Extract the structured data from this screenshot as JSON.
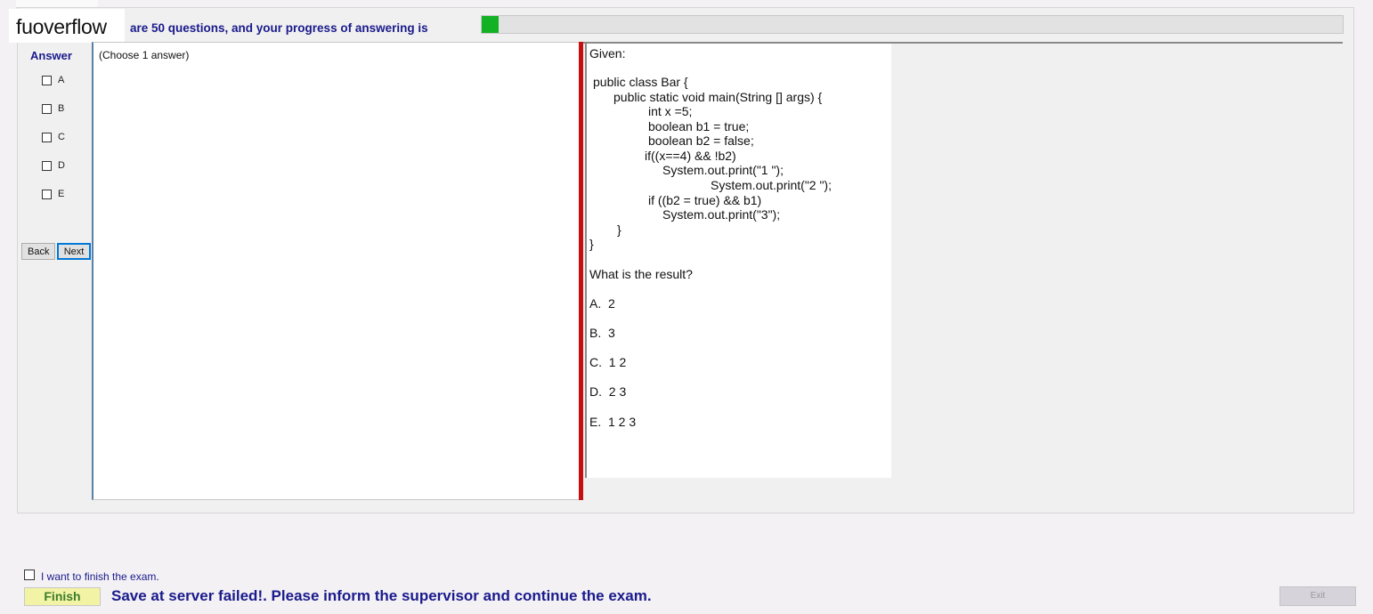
{
  "watermark": "fuoverflow",
  "progress": {
    "text": "are 50 questions, and your progress of answering is",
    "fraction": 0.02,
    "fill_color": "#13b224"
  },
  "answer": {
    "title": "Answer",
    "options": [
      "A",
      "B",
      "C",
      "D",
      "E"
    ]
  },
  "nav": {
    "back_label": "Back",
    "next_label": "Next"
  },
  "choose_text": "(Choose 1 answer)",
  "question": {
    "given": "Given:",
    "code": [
      "public class Bar {",
      "public static void main(String [] args) {",
      "int x =5;",
      "boolean b1 = true;",
      "boolean b2 = false;",
      "if((x==4) && !b2)",
      "System.out.print(\"1 \");",
      "System.out.print(\"2 \");",
      "if ((b2 = true) && b1)",
      "System.out.print(\"3\");",
      "}",
      "}"
    ],
    "prompt": "What is the result?",
    "choices": [
      "A.  2",
      "B.  3",
      "C.  1 2",
      "D.  2 3",
      "E.  1 2 3"
    ]
  },
  "footer": {
    "finish_checkbox_label": "I want to finish the exam.",
    "finish_button": "Finish",
    "save_message": "Save at server failed!. Please inform the supervisor and continue the exam.",
    "exit_button": "Exit"
  },
  "colors": {
    "accent_text": "#1a1a8c",
    "splitter": "#c70f0f"
  }
}
